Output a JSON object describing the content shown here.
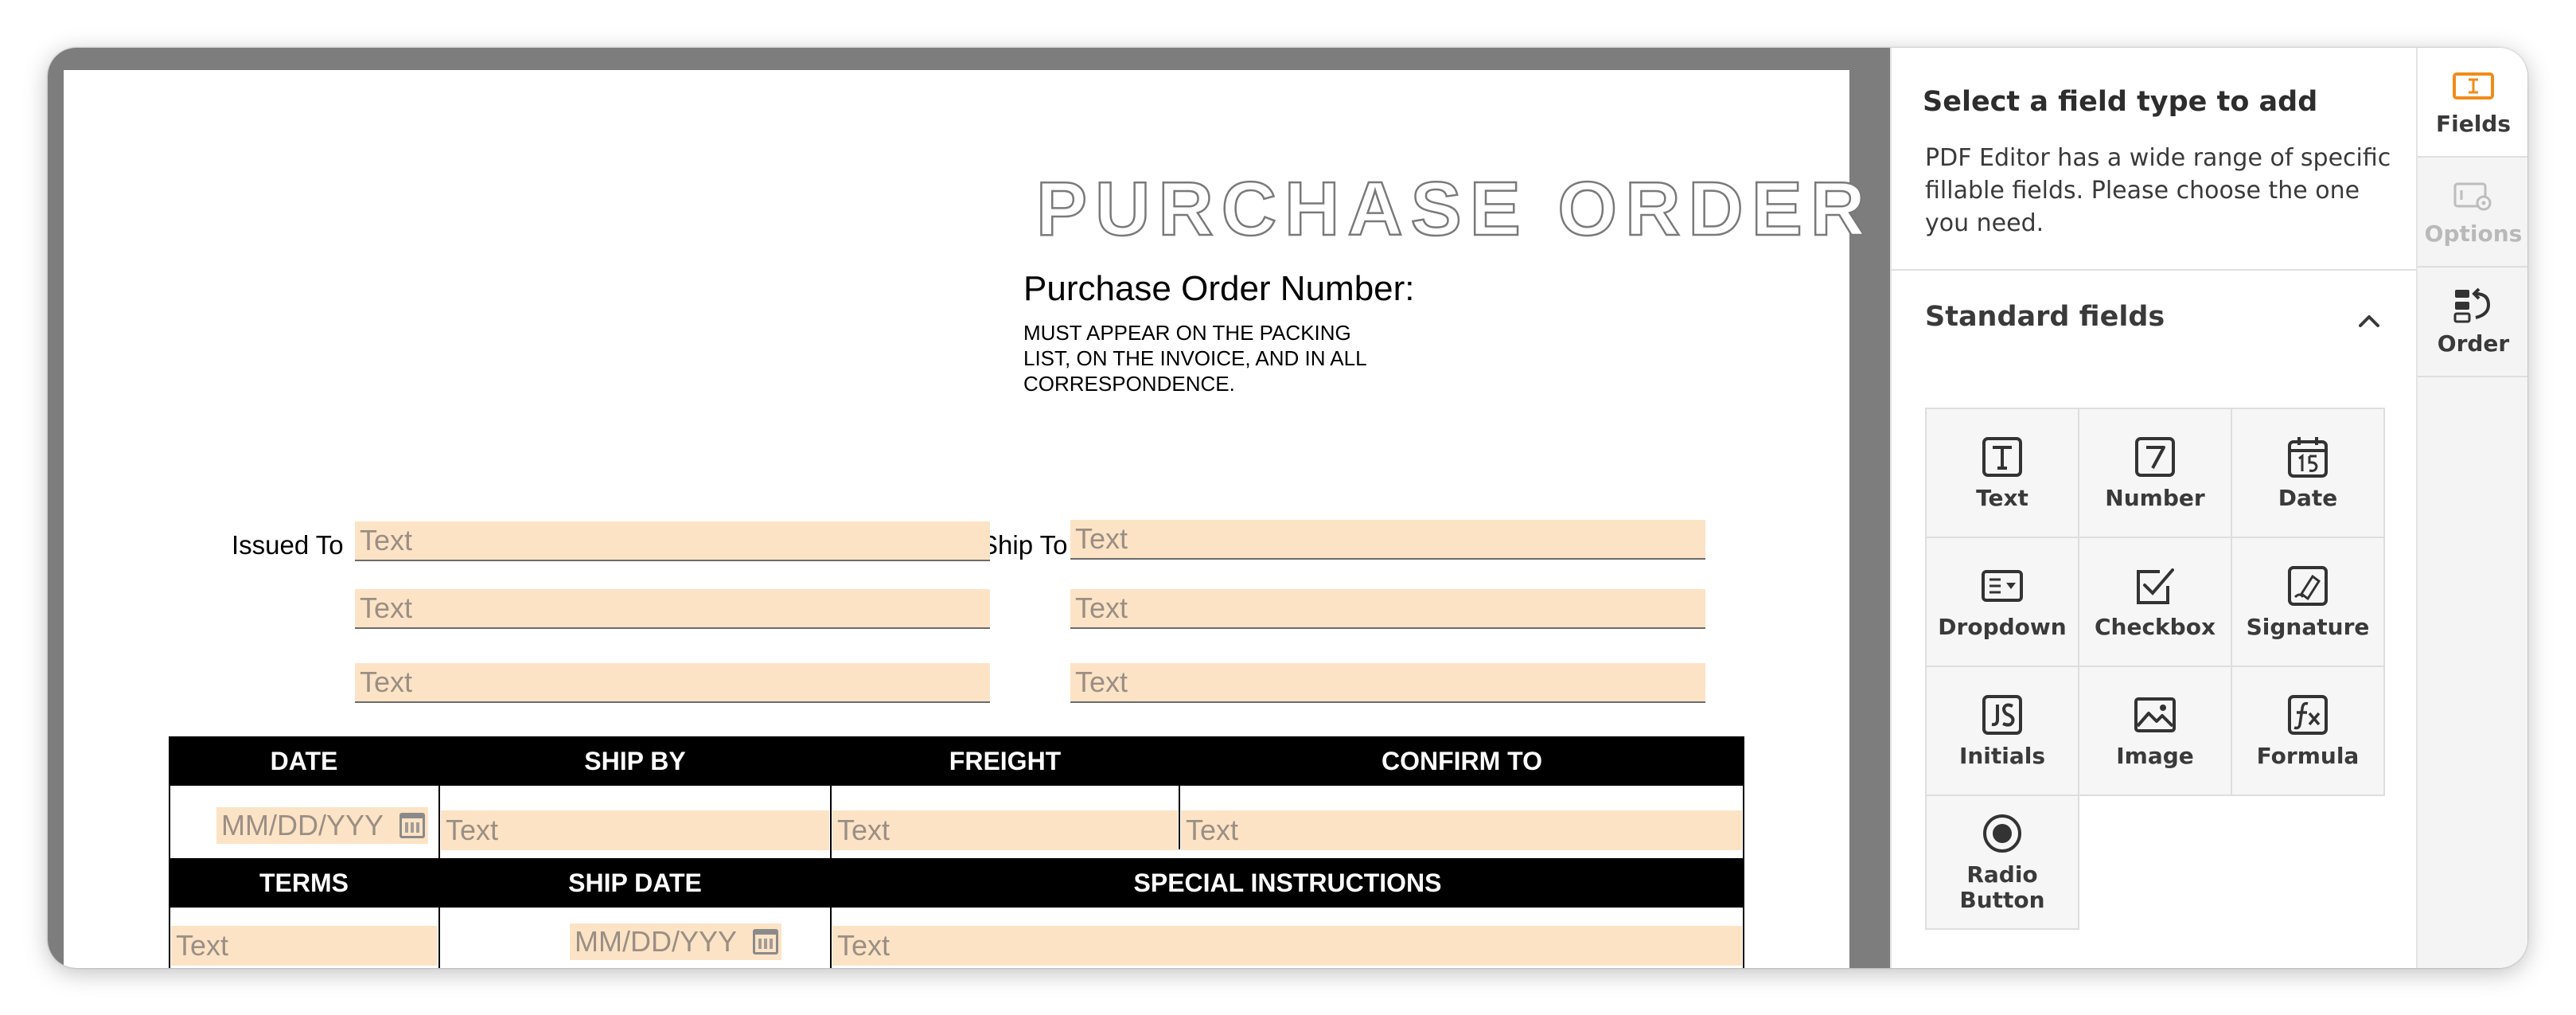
{
  "document": {
    "title": "PURCHASE ORDER",
    "po_number_label": "Purchase Order Number:",
    "po_note_lines": [
      "MUST APPEAR ON THE PACKING",
      "LIST, ON THE  INVOICE, AND IN ALL",
      "CORRESPONDENCE."
    ],
    "issued_to_label": "Issued To",
    "ship_to_label": "Ship To",
    "text_placeholder": "Text",
    "date_placeholder": "MM/DD/YYY",
    "table_headers_row1": [
      "DATE",
      "SHIP BY",
      "FREIGHT",
      "CONFIRM TO"
    ],
    "table_headers_row2": [
      "TERMS",
      "SHIP DATE",
      "SPECIAL INSTRUCTIONS"
    ]
  },
  "panel": {
    "heading": "Select a field type to add",
    "description": "PDF Editor has a wide range of specific fillable fields. Please choose the one you need.",
    "section_title": "Standard fields",
    "fields": [
      {
        "label": "Text",
        "icon": "text-field-icon"
      },
      {
        "label": "Number",
        "icon": "number-field-icon"
      },
      {
        "label": "Date",
        "icon": "date-field-icon"
      },
      {
        "label": "Dropdown",
        "icon": "dropdown-field-icon"
      },
      {
        "label": "Checkbox",
        "icon": "checkbox-field-icon"
      },
      {
        "label": "Signature",
        "icon": "signature-field-icon"
      },
      {
        "label": "Initials",
        "icon": "initials-field-icon"
      },
      {
        "label": "Image",
        "icon": "image-field-icon"
      },
      {
        "label": "Formula",
        "icon": "formula-field-icon"
      },
      {
        "label": "Radio Button",
        "icon": "radio-button-field-icon"
      }
    ]
  },
  "tabs": [
    {
      "label": "Fields",
      "icon": "fields-tab-icon",
      "state": "active"
    },
    {
      "label": "Options",
      "icon": "options-tab-icon",
      "state": "disabled"
    },
    {
      "label": "Order",
      "icon": "order-tab-icon",
      "state": "normal"
    }
  ],
  "colors": {
    "accent": "#f08c1a",
    "field_fill": "#fde3c5",
    "doc_background": "#7d7d7d"
  }
}
